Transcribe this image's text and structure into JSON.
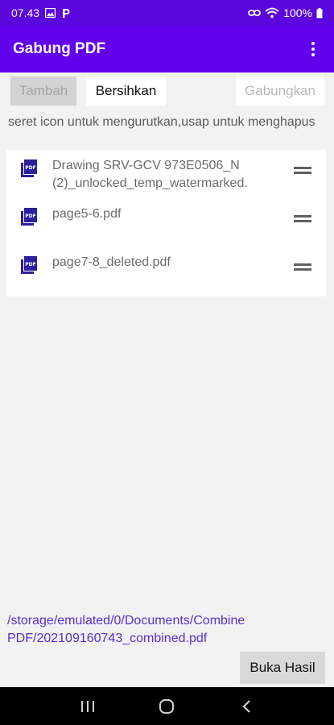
{
  "status_bar": {
    "time": "07.43",
    "left_icons": [
      "image-icon",
      "parking-icon"
    ],
    "right_icons": [
      "link-icon",
      "wifi-icon"
    ],
    "battery_text": "100%"
  },
  "app_bar": {
    "title": "Gabung PDF",
    "menu_icon": "more-vert-icon"
  },
  "toolbar": {
    "tambah_label": "Tambah",
    "bersihkan_label": "Bersihkan",
    "gabungkan_label": "Gabungkan"
  },
  "hint": "seret icon untuk mengurutkan,usap untuk menghapus",
  "files": [
    {
      "name": "Drawing SRV-GCV 973E0506_N (2)_unlocked_temp_watermarked.",
      "icon": "pdf-icon"
    },
    {
      "name": "page5-6.pdf",
      "icon": "pdf-icon"
    },
    {
      "name": "page7-8_deleted.pdf",
      "icon": "pdf-icon"
    }
  ],
  "result_path": "/storage/emulated/0/Documents/Combine PDF/202109160743_combined.pdf",
  "open_result_label": "Buka Hasil",
  "nav_bar": [
    "recents-icon",
    "home-icon",
    "back-icon"
  ],
  "colors": {
    "primary": "#6200ee",
    "status_bar": "#5c06de",
    "link": "#5a2ed0",
    "pdf_icon": "#2b1f9e"
  }
}
